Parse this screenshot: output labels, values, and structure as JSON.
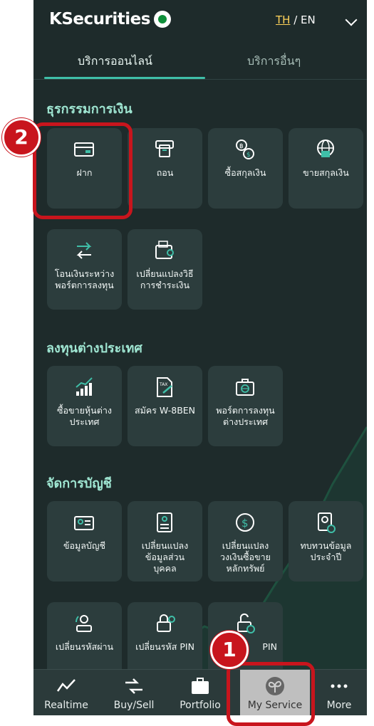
{
  "header": {
    "brand": "KSecurities",
    "lang_th": "TH",
    "lang_sep": " / ",
    "lang_en": "EN"
  },
  "tabs": [
    {
      "label": "บริการออนไลน์"
    },
    {
      "label": "บริการอื่นๆ"
    }
  ],
  "sections": [
    {
      "title": "ธุรกรรมการเงิน",
      "items": [
        {
          "label": "ฝาก",
          "icon": "card-icon"
        },
        {
          "label": "ถอน",
          "icon": "withdraw-icon"
        },
        {
          "label": "ซื้อสกุลเงิน",
          "icon": "currency-exchange-icon"
        },
        {
          "label": "ขายสกุลเงิน",
          "icon": "globe-card-icon"
        },
        {
          "label": "โอนเงินระหว่าง\nพอร์ตการลงทุน",
          "icon": "transfer-arrows-icon"
        },
        {
          "label": "เปลี่ยนแปลงวิธี\nการชำระเงิน",
          "icon": "wallet-icon"
        }
      ]
    },
    {
      "title": "ลงทุนต่างประเทศ",
      "items": [
        {
          "label": "ซื้อขายหุ้นต่าง\nประเทศ",
          "icon": "growth-chart-icon"
        },
        {
          "label": "สมัคร W-8BEN",
          "icon": "tax-form-icon"
        },
        {
          "label": "พอร์ตการลงทุน\nต่างประเทศ",
          "icon": "globe-briefcase-icon"
        }
      ]
    },
    {
      "title": "จัดการบัญชี",
      "items": [
        {
          "label": "ข้อมูลบัญชี",
          "icon": "id-card-icon"
        },
        {
          "label": "เปลี่ยนแปลง\nข้อมูลส่วน\nบุคคล",
          "icon": "profile-doc-icon"
        },
        {
          "label": "เปลี่ยนแปลง\nวงเงินซื้อขาย\nหลักทรัพย์",
          "icon": "credit-limit-icon"
        },
        {
          "label": "ทบทวนข้อมูล\nประจำปี",
          "icon": "review-doc-icon"
        },
        {
          "label": "เปลี่ยนรหัสผ่าน",
          "icon": "password-icon"
        },
        {
          "label": "เปลี่ยนรหัส PIN",
          "icon": "pin-lock-icon"
        },
        {
          "label": "PIN",
          "icon": "unlock-icon"
        }
      ]
    }
  ],
  "nav": [
    {
      "label": "Realtime",
      "icon": "realtime-icon"
    },
    {
      "label": "Buy/Sell",
      "icon": "buy-sell-icon"
    },
    {
      "label": "Portfolio",
      "icon": "portfolio-icon"
    },
    {
      "label": "My Service",
      "icon": "my-service-icon",
      "active": true
    },
    {
      "label": "More",
      "icon": "more-icon"
    }
  ],
  "annotations": [
    {
      "number": "1"
    },
    {
      "number": "2"
    }
  ],
  "colors": {
    "background": "#1e2b2b",
    "tile": "#2c3d3d",
    "accent": "#3fbfa8",
    "section_title": "#9fe6d2",
    "marker": "#c8151d",
    "nav_active": "#bfbfbf"
  }
}
